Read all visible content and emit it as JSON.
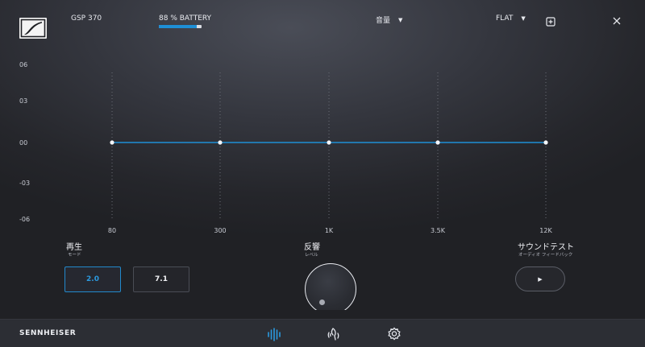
{
  "header": {
    "device_name": "GSP 370",
    "battery_text": "88 % BATTERY",
    "battery_level": 0.88,
    "preset_center": "音量",
    "preset_right": "FLAT",
    "caret_glyph": "▼"
  },
  "eq": {
    "y_labels": [
      "06",
      "03",
      "00",
      "-03",
      "-06"
    ],
    "bands": [
      "80",
      "300",
      "1K",
      "3.5K",
      "12K"
    ],
    "gains": [
      0,
      0,
      0,
      0,
      0
    ],
    "ylim": [
      -6,
      6
    ],
    "line_color": "#1e8fd6"
  },
  "controls": {
    "playback_title": "再生",
    "playback_sub": "モード",
    "mode_buttons": [
      "2.0",
      "7.1"
    ],
    "active_mode": "2.0",
    "reverb_title": "反響",
    "reverb_sub": "レベル",
    "reverb_level": 0,
    "soundtest_title": "サウンドテスト",
    "soundtest_sub": "オーディオ フィードバック",
    "play_glyph": "▶"
  },
  "footer": {
    "brand": "SENNHEISER",
    "nav_icons": [
      "equalizer-icon",
      "voice-icon",
      "settings-icon"
    ],
    "active_nav": "equalizer-icon",
    "accent": "#2b9ae0"
  }
}
